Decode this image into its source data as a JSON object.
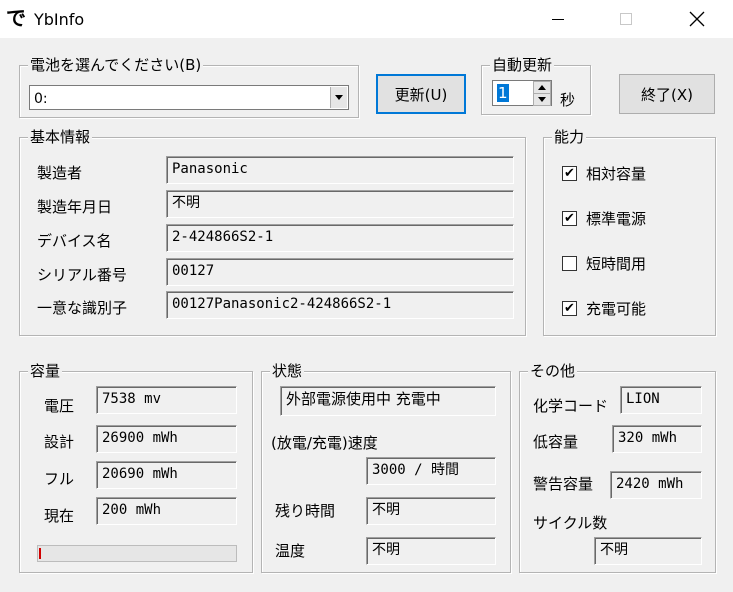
{
  "window": {
    "icon_glyph": "で",
    "title": "YbInfo"
  },
  "battery_select": {
    "legend": "電池を選んでください(B)",
    "selected": "0:"
  },
  "buttons": {
    "update": "更新(U)",
    "exit": "終了(X)"
  },
  "auto_update": {
    "legend": "自動更新",
    "value": "1",
    "unit": "秒"
  },
  "basic_info": {
    "legend": "基本情報",
    "rows": [
      {
        "label": "製造者",
        "value": "Panasonic"
      },
      {
        "label": "製造年月日",
        "value": "不明"
      },
      {
        "label": "デバイス名",
        "value": "2-424866S2-1"
      },
      {
        "label": "シリアル番号",
        "value": "00127"
      },
      {
        "label": "一意な識別子",
        "value": "00127Panasonic2-424866S2-1"
      }
    ]
  },
  "capability": {
    "legend": "能力",
    "items": [
      {
        "label": "相対容量",
        "checked": true,
        "mark": "✔"
      },
      {
        "label": "標準電源",
        "checked": true,
        "mark": "✔"
      },
      {
        "label": "短時間用",
        "checked": false,
        "mark": ""
      },
      {
        "label": "充電可能",
        "checked": true,
        "mark": "✔"
      }
    ]
  },
  "capacity": {
    "legend": "容量",
    "rows": [
      {
        "label": "電圧",
        "value": "7538 mv"
      },
      {
        "label": "設計",
        "value": "26900 mWh"
      },
      {
        "label": "フル",
        "value": "20690 mWh"
      },
      {
        "label": "現在",
        "value": "200 mWh"
      }
    ],
    "level_fraction": 0.01,
    "level_color": "#d00000"
  },
  "status": {
    "legend": "状態",
    "state": "外部電源使用中 充電中",
    "rate_label": "(放電/充電)速度",
    "rate_value": "3000 / 時間",
    "remaining_label": "残り時間",
    "remaining_value": "不明",
    "temperature_label": "温度",
    "temperature_value": "不明"
  },
  "other": {
    "legend": "その他",
    "chemistry_label": "化学コード",
    "chemistry_value": "LION",
    "low_label": "低容量",
    "low_value": "320 mWh",
    "warning_label": "警告容量",
    "warning_value": "2420 mWh",
    "cycle_label": "サイクル数",
    "cycle_value": "不明"
  },
  "colors": {
    "accent": "#0078d7",
    "background": "#f0f0f0"
  }
}
